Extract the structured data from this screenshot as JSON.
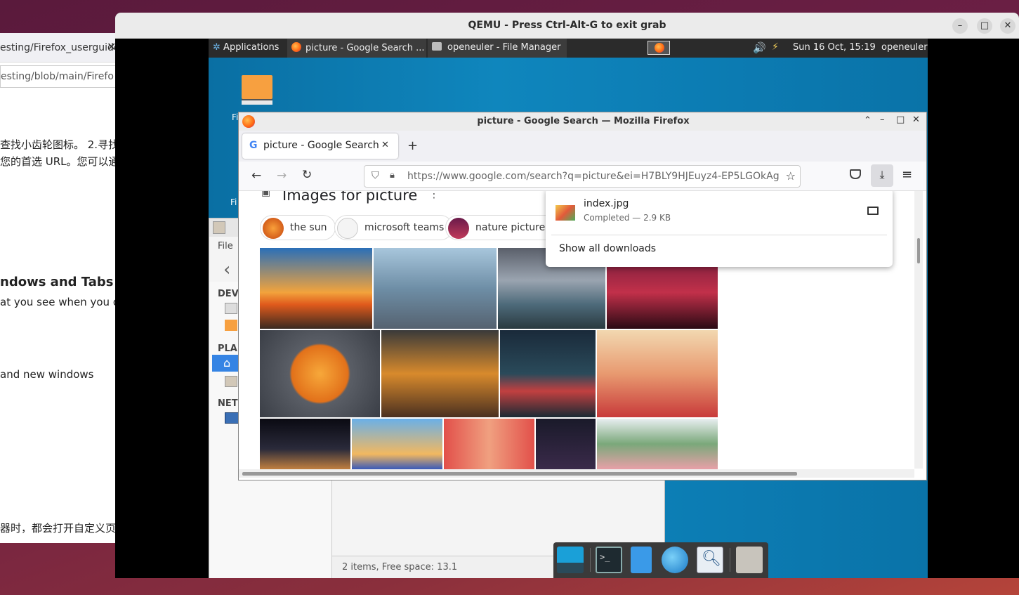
{
  "host_browser": {
    "tab_label": "esting/Firefox_userguide",
    "url_text": "esting/blob/main/Firefo",
    "line1": "查找小齿轮图标。 2.寻找",
    "line2": "您的首选 URL。您可以通",
    "heading": "ndows and Tabs",
    "line3": "at you see when you o",
    "line4": " and new windows",
    "line5": "器时，都会打开自定义页"
  },
  "qemu": {
    "title": "QEMU - Press Ctrl-Alt-G to exit grab"
  },
  "guest_panel": {
    "applications": "Applications",
    "task1": "picture - Google Search ...",
    "task2": "openeuler - File Manager",
    "clock": "Sun 16 Oct, 15:19",
    "user": "openeuler"
  },
  "desktop": {
    "icon1_label": "Fi",
    "icon2_label": "Fi"
  },
  "file_manager": {
    "menu_file": "File",
    "section_devices": "DEV",
    "section_places": "PLA",
    "section_network": "NET",
    "status": "2 items, Free space: 13.1"
  },
  "firefox": {
    "window_title": "picture - Google Search — Mozilla Firefox",
    "tab_title": "picture - Google Search",
    "url": "https://www.google.com/search?q=picture&ei=H7BLY9HJEuyz4-EP5LGOkAg",
    "images_heading": "Images for picture",
    "chips": [
      "the sun",
      "microsoft teams",
      "nature pictures"
    ],
    "downloads": {
      "file_name": "index.jpg",
      "status": "Completed — 2.9 KB",
      "show_all": "Show all downloads"
    }
  },
  "colors": {
    "guest_desktop": "#0c7cb3",
    "panel": "#2b2b2b",
    "firefox_accent": "#0060df"
  }
}
